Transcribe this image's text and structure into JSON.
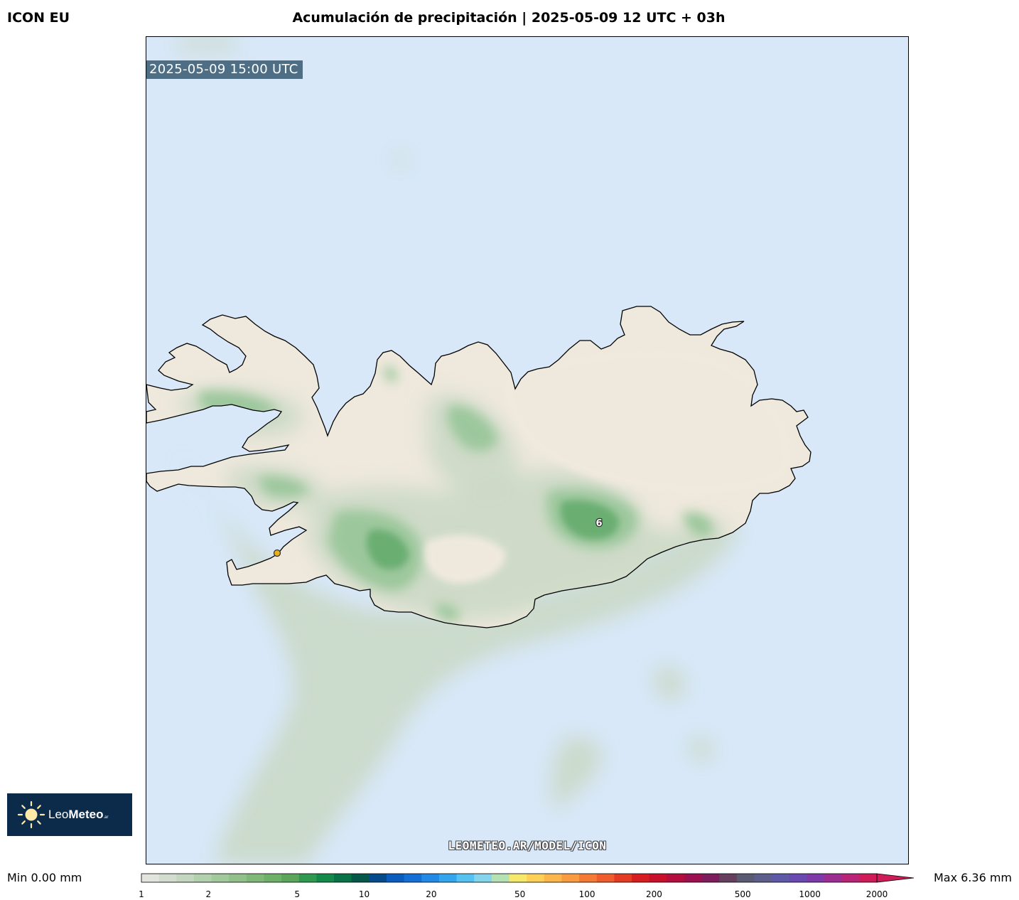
{
  "header": {
    "model_name": "ICON EU",
    "title": "Acumulación de precipitación | 2025-05-09 12 UTC + 03h"
  },
  "map": {
    "timestamp": "2025-05-09 15:00 UTC",
    "watermark": "LEOMETEO.AR/MODEL/ICON",
    "max_marker_label": "6",
    "colors": {
      "ocean": "#d8e8f8",
      "land": "#efe9dd",
      "precip_light": "#c9d8c4",
      "precip_mid": "#9cc79c",
      "precip_heavy": "#6aae72",
      "station_marker": "#e8b01c"
    }
  },
  "logo": {
    "name_regular": "Leo",
    "name_bold": "Meteo",
    "suffix": ".ar"
  },
  "colorbar": {
    "min_label": "Min 0.00 mm",
    "max_label": "Max 6.36 mm",
    "tick_labels": [
      "1",
      "2",
      "5",
      "10",
      "20",
      "50",
      "100",
      "200",
      "500",
      "1000",
      "2000"
    ],
    "colors": [
      "#e2e4de",
      "#d2dccf",
      "#c3d6c0",
      "#b2cfae",
      "#a2c89d",
      "#91c08b",
      "#80b87a",
      "#6eb069",
      "#5ca65b",
      "#2f9a4f",
      "#13894a",
      "#077346",
      "#06574a",
      "#054a8a",
      "#0a5cbf",
      "#1570d5",
      "#2289e5",
      "#34a6ee",
      "#55c2f2",
      "#86d4ec",
      "#b6e1b4",
      "#f6e86a",
      "#fed057",
      "#fcb64b",
      "#f99b40",
      "#f57a36",
      "#ef5c2e",
      "#e43b25",
      "#d81d20",
      "#c8102a",
      "#b40e3e",
      "#9c1050",
      "#7e1c5e",
      "#64405e",
      "#5a5a72",
      "#5d5f8a",
      "#5e5aa8",
      "#6a4ab0",
      "#7e3aa8",
      "#9c2e92",
      "#b82576",
      "#cf1b57"
    ]
  }
}
